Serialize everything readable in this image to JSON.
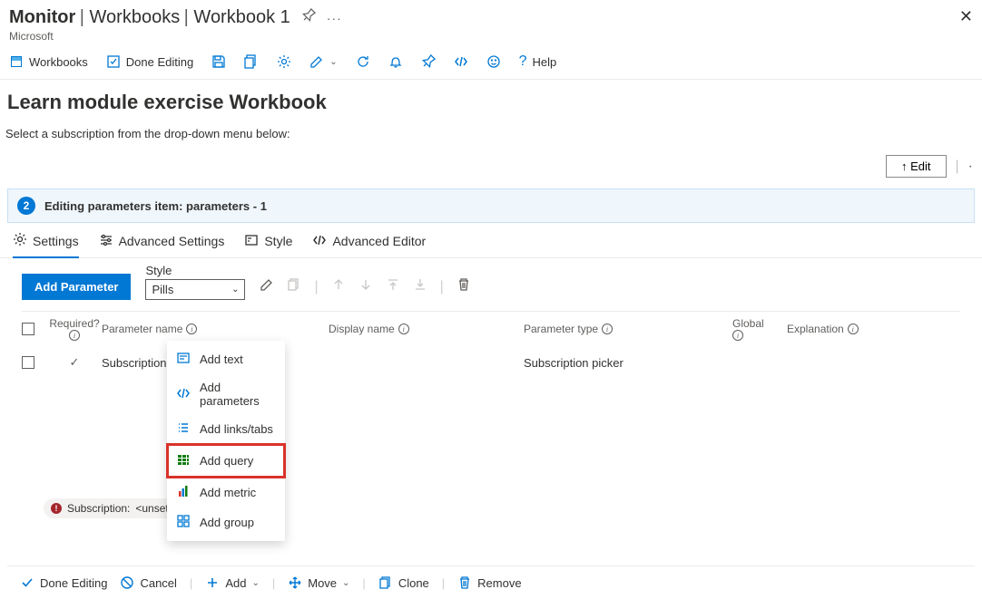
{
  "header": {
    "breadcrumb": [
      "Monitor",
      "Workbooks",
      "Workbook 1"
    ],
    "subtitle": "Microsoft"
  },
  "toolbar": {
    "workbooks": "Workbooks",
    "done": "Done Editing",
    "help": "Help"
  },
  "content": {
    "title": "Learn module exercise Workbook",
    "description": "Select a subscription from the drop-down menu below:",
    "edit_btn": "↑ Edit"
  },
  "banner": {
    "num": "2",
    "text": "Editing parameters item: parameters - 1"
  },
  "tabs": {
    "settings": "Settings",
    "advanced": "Advanced Settings",
    "style": "Style",
    "editor": "Advanced Editor"
  },
  "param_tb": {
    "add_btn": "Add Parameter",
    "style_label": "Style",
    "style_value": "Pills"
  },
  "table": {
    "headers": {
      "required": "Required?",
      "pname": "Parameter name",
      "dname": "Display name",
      "ptype": "Parameter type",
      "global": "Global",
      "expl": "Explanation"
    },
    "row": {
      "pname": "Subscription",
      "ptype": "Subscription picker"
    }
  },
  "add_menu": {
    "text": "Add text",
    "params": "Add parameters",
    "links": "Add links/tabs",
    "query": "Add query",
    "metric": "Add metric",
    "group": "Add group"
  },
  "pill": {
    "label": "Subscription:",
    "value": "<unset>"
  },
  "footer": {
    "done": "Done Editing",
    "cancel": "Cancel",
    "add": "Add",
    "move": "Move",
    "clone": "Clone",
    "remove": "Remove"
  }
}
